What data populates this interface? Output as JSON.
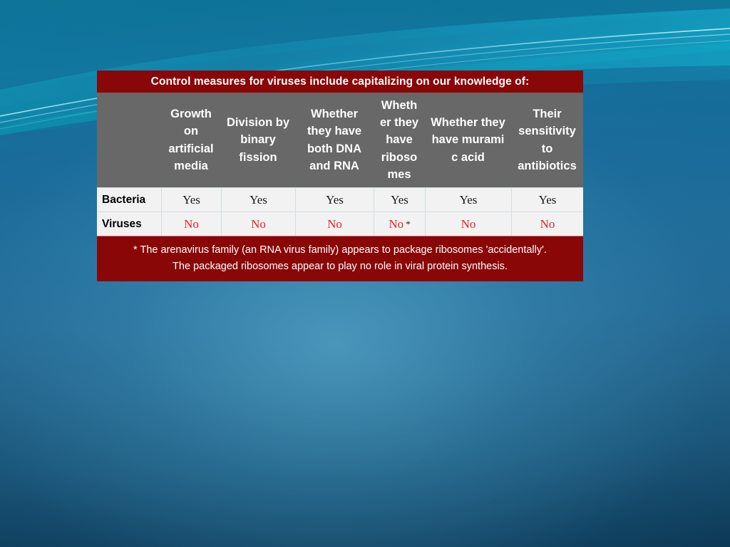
{
  "slide": {
    "background": {
      "base_color": "#1b6e9c",
      "dark_color": "#0c3753",
      "accent_color": "#1aa7c8"
    }
  },
  "table": {
    "title": "Control measures for viruses include capitalizing on our knowledge of:",
    "title_bg": "#8a0707",
    "header_bg": "#686868",
    "row_bg": "#f2f2f2",
    "yes_color": "#1a1a1a",
    "no_color": "#e8202a",
    "columns": [
      "",
      "Growth on artificial media",
      "Division by binary fission",
      "Whether they have both DNA and RNA",
      "Wheth er they have riboso mes",
      "Whether they have  murami c acid",
      "Their sensitivity to antibiotics"
    ],
    "rows": [
      {
        "label": "Bacteria",
        "values": [
          "Yes",
          "Yes",
          "Yes",
          "Yes",
          "Yes",
          "Yes"
        ],
        "footnote_marker_index": -1
      },
      {
        "label": "Viruses",
        "values": [
          "No",
          "No",
          "No",
          "No",
          "No",
          "No"
        ],
        "footnote_marker": "*",
        "footnote_marker_index": 3
      }
    ],
    "footnote_line1": "* The arenavirus family (an RNA virus family) appears to package ribosomes 'accidentally'.",
    "footnote_line2": "The packaged ribosomes appear to play no role in viral protein synthesis."
  }
}
